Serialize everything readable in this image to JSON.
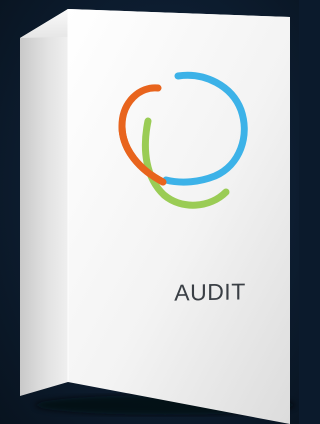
{
  "product": {
    "name": "AUDIT",
    "logo_icon": "triskele-logo-icon",
    "colors": {
      "background": "#0b1a2c",
      "box_front": "#f2f2f2",
      "arc_orange": "#e8641d",
      "arc_blue": "#3cb2e8",
      "arc_green": "#9acc55",
      "label": "#3a3f45"
    }
  }
}
